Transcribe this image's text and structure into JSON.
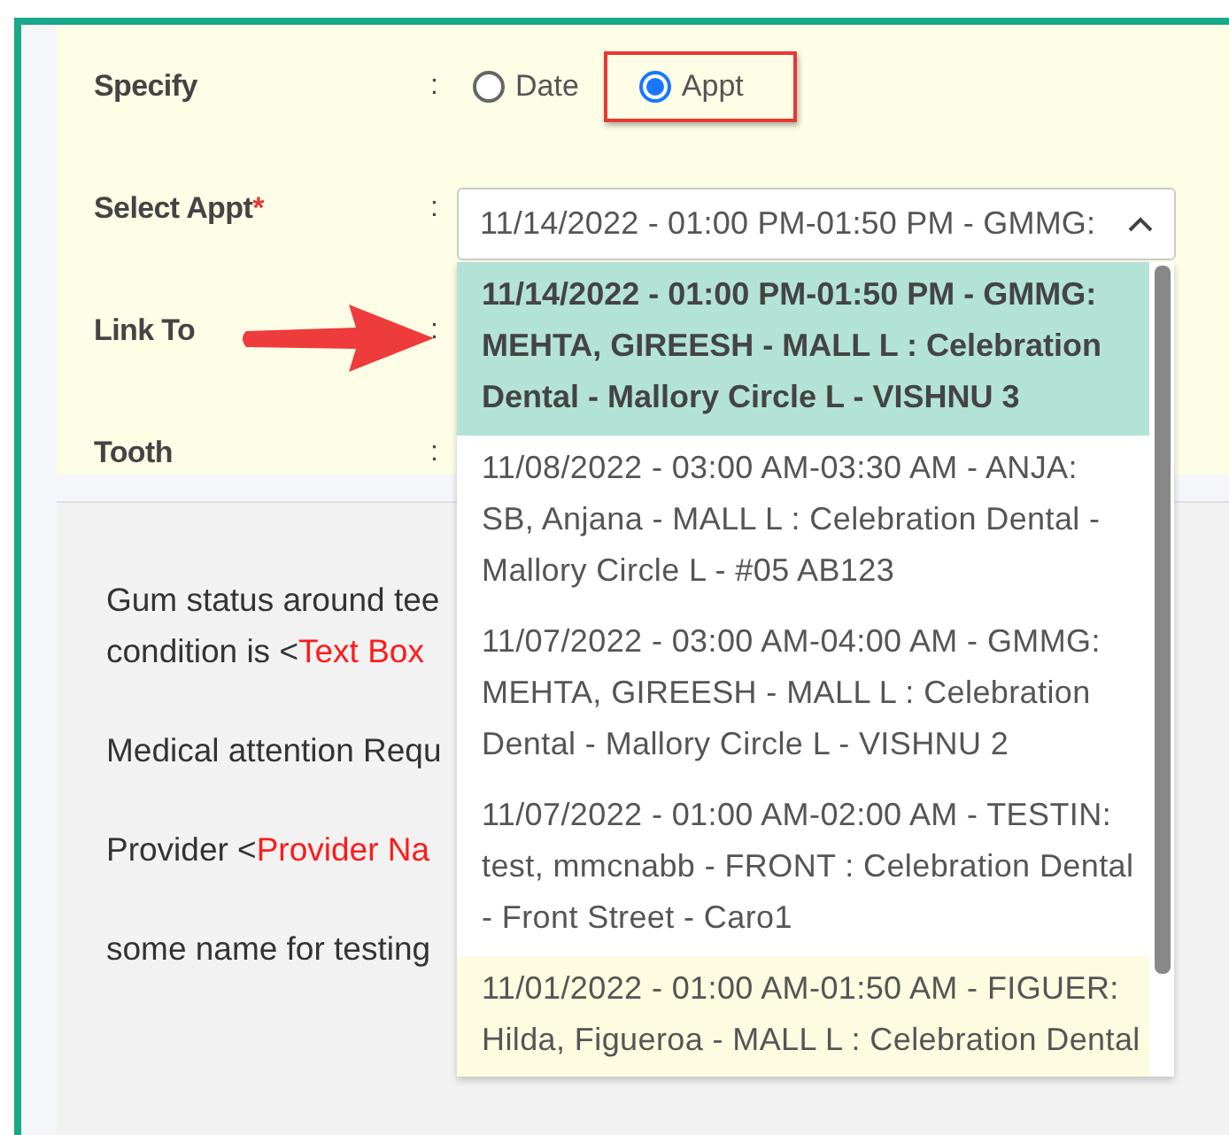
{
  "form": {
    "fields": [
      {
        "kind": "radio",
        "label": "Specify",
        "colon": ":",
        "options": [
          {
            "label": "Date",
            "selected": false,
            "annotated": false
          },
          {
            "label": "Appt",
            "selected": true,
            "annotated": true
          }
        ]
      },
      {
        "kind": "select",
        "label": "Select Appt",
        "required_mark": "*",
        "colon": ":",
        "value": "11/14/2022 - 01:00 PM-01:50 PM - GMMG:",
        "expanded": true
      },
      {
        "kind": "empty",
        "label": "Link To",
        "colon": ":",
        "pointer_arrow": true
      },
      {
        "kind": "empty",
        "label": "Tooth",
        "colon": ":"
      }
    ]
  },
  "dropdown": {
    "options": [
      {
        "text": "11/14/2022 - 01:00 PM-01:50 PM - GMMG:\nMEHTA, GIREESH - MALL L : Celebration\nDental - Mallory Circle L - VISHNU 3",
        "selected": true,
        "hovered": false
      },
      {
        "text": "11/08/2022 - 03:00 AM-03:30 AM - ANJA:\nSB, Anjana - MALL L : Celebration Dental -\nMallory Circle L - #05 AB123",
        "selected": false,
        "hovered": false
      },
      {
        "text": "11/07/2022 - 03:00 AM-04:00 AM - GMMG:\nMEHTA, GIREESH - MALL L : Celebration\nDental - Mallory Circle L - VISHNU 2",
        "selected": false,
        "hovered": false
      },
      {
        "text": "11/07/2022 - 01:00 AM-02:00 AM - TESTIN:\ntest, mmcnabb - FRONT : Celebration Dental\n- Front Street - Caro1",
        "selected": false,
        "hovered": false
      },
      {
        "text": "11/01/2022 - 01:00 AM-01:50 AM - FIGUER:\nHilda, Figueroa - MALL L : Celebration Dental",
        "selected": false,
        "hovered": true
      }
    ]
  },
  "template": {
    "paragraphs": [
      {
        "lines": [
          {
            "parts": [
              {
                "text": "Gum status around tee",
                "kind": "plain"
              }
            ]
          },
          {
            "parts": [
              {
                "text": "condition is <",
                "kind": "plain"
              },
              {
                "text": "Text Box",
                "kind": "placeholder"
              }
            ]
          }
        ]
      },
      {
        "lines": [
          {
            "parts": [
              {
                "text": "Medical attention Requ",
                "kind": "plain"
              }
            ]
          }
        ]
      },
      {
        "lines": [
          {
            "parts": [
              {
                "text": "Provider <",
                "kind": "plain"
              },
              {
                "text": "Provider Na",
                "kind": "placeholder"
              }
            ]
          }
        ]
      },
      {
        "lines": [
          {
            "parts": [
              {
                "text": "some name for testing",
                "kind": "plain"
              }
            ]
          }
        ]
      }
    ]
  }
}
